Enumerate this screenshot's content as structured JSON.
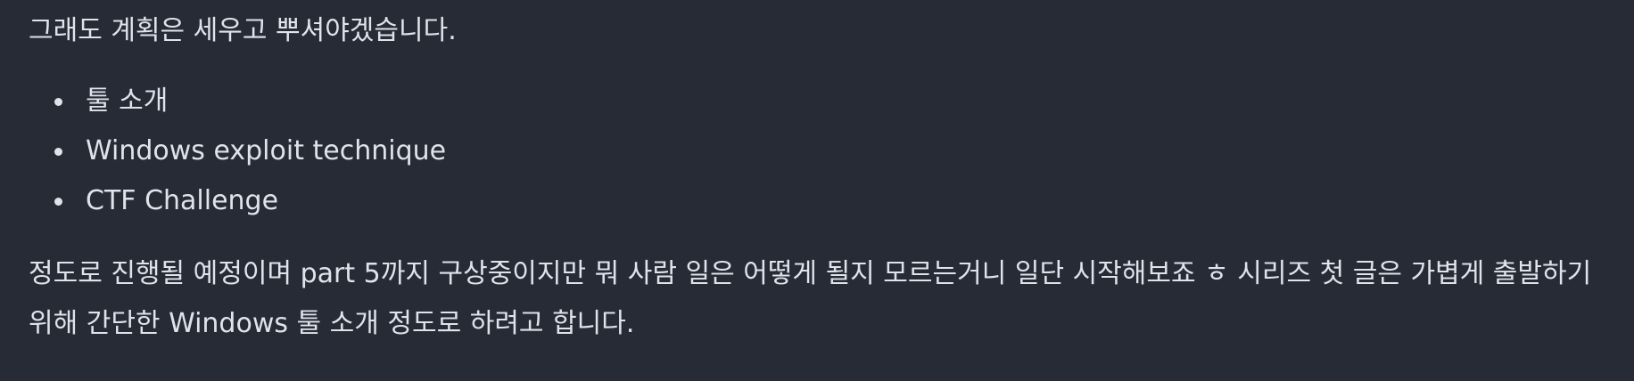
{
  "document": {
    "intro": "그래도 계획은 세우고 뿌셔야겠습니다.",
    "list": [
      "툴 소개",
      "Windows exploit technique",
      "CTF Challenge"
    ],
    "body": "정도로 진행될 예정이며 part 5까지 구상중이지만 뭐 사람 일은 어떻게 될지 모르는거니 일단 시작해보죠 ㅎ 시리즈 첫 글은 가볍게 출발하기 위해 간단한 Windows 툴 소개 정도로 하려고 합니다."
  },
  "colors": {
    "background": "#262b36",
    "text": "#dfe3ea"
  }
}
